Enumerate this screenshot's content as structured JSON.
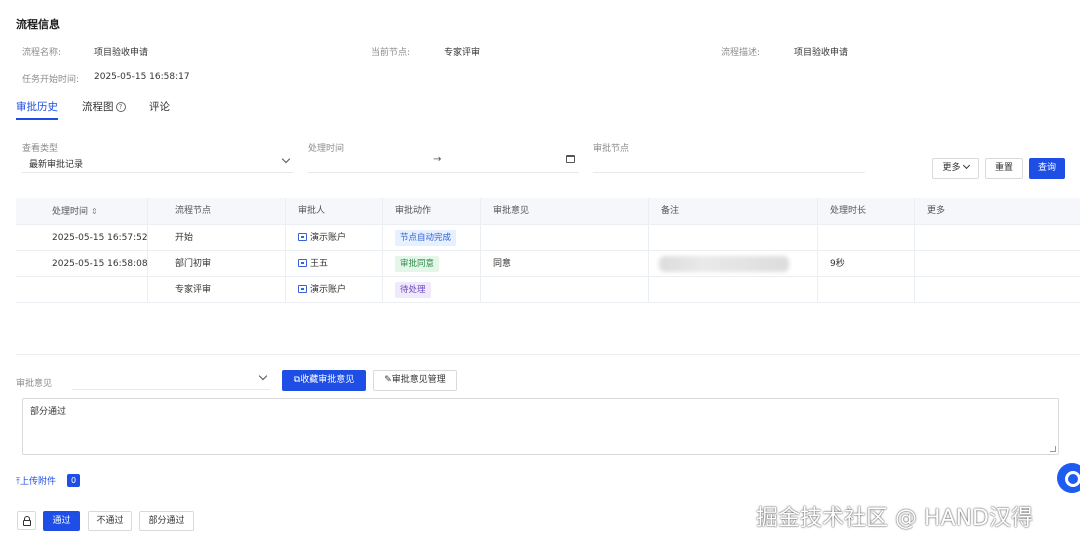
{
  "section_title": "流程信息",
  "info": {
    "process_name_label": "流程名称:",
    "process_name_value": "项目验收申请",
    "current_node_label": "当前节点:",
    "current_node_value": "专家评审",
    "process_desc_label": "流程描述:",
    "process_desc_value": "项目验收申请",
    "task_start_label": "任务开始时间:",
    "task_start_value": "2025-05-15 16:58:17"
  },
  "tabs": [
    {
      "label": "审批历史",
      "active": true
    },
    {
      "label": "流程图",
      "active": false,
      "icon": "help-icon"
    },
    {
      "label": "评论",
      "active": false
    }
  ],
  "filters": {
    "view_type_label": "查看类型",
    "view_type_value": "最新审批记录",
    "process_time_label": "处理时间",
    "process_time_sep": "→",
    "approval_node_label": "审批节点"
  },
  "buttons": {
    "more": "更多",
    "reset": "重置",
    "query": "查询",
    "save_opinion": "收藏审批意见",
    "manage_opinion": "审批意见管理",
    "pass": "通过",
    "reject": "不通过",
    "partial_pass": "部分通过"
  },
  "table": {
    "headers": [
      "处理时间",
      "流程节点",
      "审批人",
      "审批动作",
      "审批意见",
      "备注",
      "处理时长",
      "更多"
    ],
    "rows": [
      {
        "time": "2025-05-15 16:57:52",
        "node": "开始",
        "approver": "演示账户",
        "action": "节点自动完成",
        "action_color": "blue",
        "opinion": "",
        "remark_blurred": false,
        "duration": ""
      },
      {
        "time": "2025-05-15 16:58:08",
        "node": "部门初审",
        "approver": "王五",
        "action": "审批同意",
        "action_color": "green",
        "opinion": "同意",
        "remark_blurred": true,
        "duration": "9秒"
      },
      {
        "time": "",
        "node": "专家评审",
        "approver": "演示账户",
        "action": "待处理",
        "action_color": "purple",
        "opinion": "",
        "remark_blurred": false,
        "duration": ""
      }
    ]
  },
  "opinion": {
    "label": "审批意见",
    "text": "部分通过"
  },
  "upload": {
    "label": "上传附件",
    "count": "0"
  },
  "watermark": "掘金技术社区 @ HAND汉得",
  "colors": {
    "primary": "#1e4ee6",
    "tag_blue": "#e6f0ff",
    "tag_green": "#e3f6e8",
    "tag_purple": "#efe9fb"
  }
}
